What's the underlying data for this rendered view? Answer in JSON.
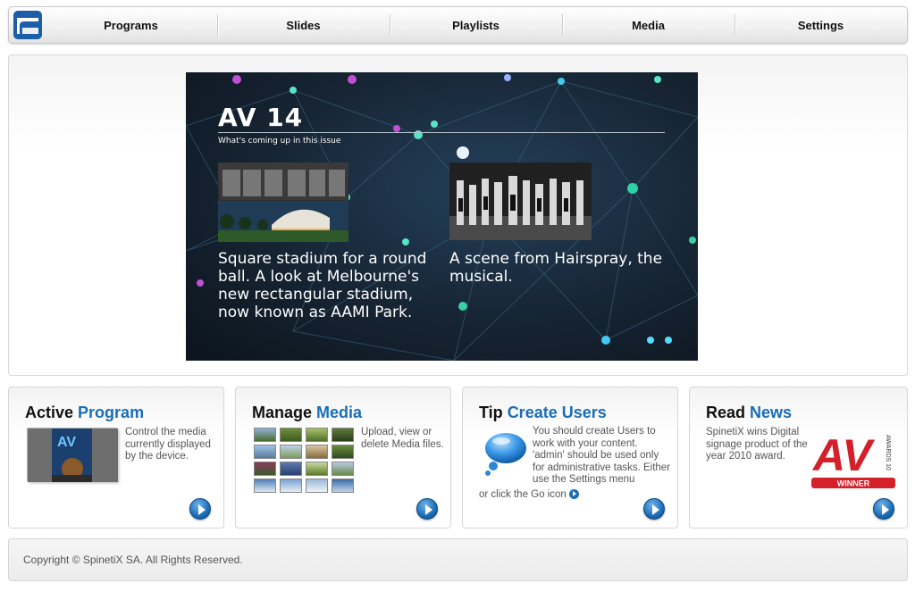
{
  "nav": {
    "logo_icon": "spinetix-logo-icon",
    "items": [
      {
        "label": "Programs"
      },
      {
        "label": "Slides"
      },
      {
        "label": "Playlists"
      },
      {
        "label": "Media"
      },
      {
        "label": "Settings"
      }
    ]
  },
  "slide": {
    "title": "AV 14",
    "subtitle": "What's coming up in this issue",
    "items": [
      {
        "caption": "Square stadium for a round ball. A look at Melbourne's new rectangular stadium, now known as AAMI Park."
      },
      {
        "caption": "A scene from Hairspray, the musical."
      }
    ]
  },
  "cards": [
    {
      "title_plain": "Active",
      "title_highlight": "Program",
      "text": "Control the media currently displayed by the device."
    },
    {
      "title_plain": "Manage",
      "title_highlight": "Media",
      "text": "Upload, view or delete Media files."
    },
    {
      "title_plain": "Tip",
      "title_highlight": "Create Users",
      "text": "You should create Users to work with your content. 'admin' should be used only for administrative tasks. Either use the Settings menu",
      "text_tail": "or click the Go icon"
    },
    {
      "title_plain": "Read",
      "title_highlight": "News",
      "text": "SpinetiX wins Digital signage product of the year 2010 award.",
      "logo_text": "AV",
      "logo_side": "AWARDS 10",
      "logo_banner": "WINNER"
    }
  ],
  "footer": {
    "copyright": "Copyright © SpinetiX SA. All Rights Reserved."
  },
  "colors": {
    "accent": "#1a6db6",
    "award_red": "#d4202a"
  }
}
